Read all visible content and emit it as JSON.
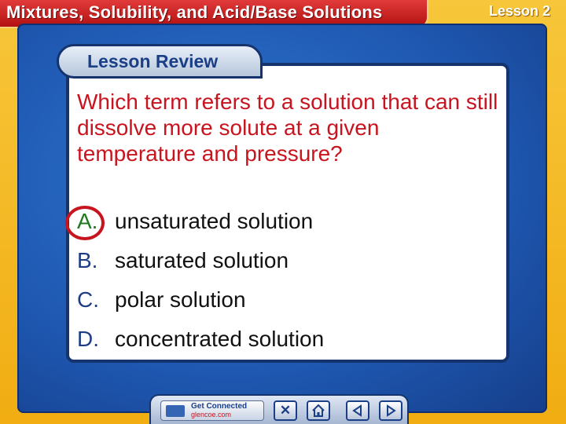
{
  "header": {
    "title": "Mixtures, Solubility, and Acid/Base Solutions",
    "lesson": "Lesson 2"
  },
  "panel": {
    "tab_label": "Lesson Review",
    "question": "Which term refers to a solution that can still dissolve more solute at a given temperature and pressure?",
    "answers": [
      {
        "letter": "A.",
        "text": "unsaturated solution"
      },
      {
        "letter": "B.",
        "text": "saturated solution"
      },
      {
        "letter": "C.",
        "text": "polar solution"
      },
      {
        "letter": "D.",
        "text": "concentrated solution"
      }
    ],
    "correct_answer": "A."
  },
  "nav": {
    "get_connected": "Get Connected",
    "site": "glencoe.com",
    "icons": [
      "close-icon",
      "home-icon",
      "back-arrow-icon",
      "forward-arrow-icon"
    ]
  },
  "colors": {
    "frame": "#f3b51a",
    "title_bar": "#c41e1e",
    "panel_blue": "#1e57b0",
    "question_red": "#c8141e",
    "correct_green": "#1f7a1f"
  }
}
